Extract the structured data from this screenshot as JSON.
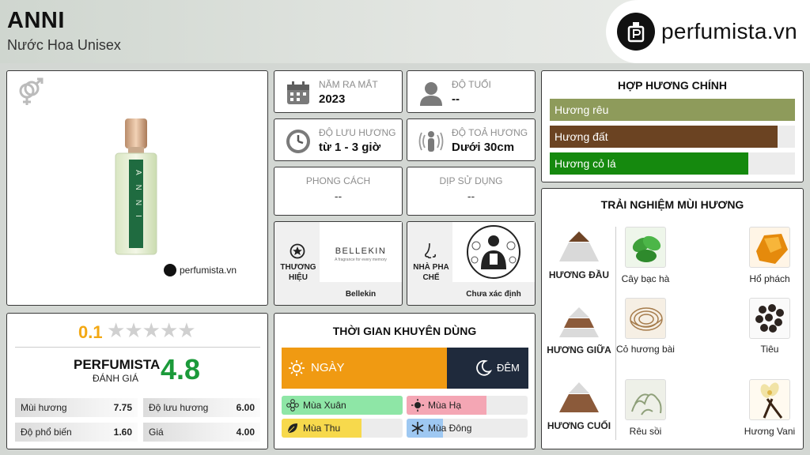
{
  "product": {
    "name": "ANNI",
    "subtitle": "Nước Hoa Unisex",
    "bottle_label": "ANNI"
  },
  "logo": {
    "text": "perfumista.vn"
  },
  "image_watermark": "perfumista.vn",
  "info": {
    "year_label": "NĂM RA MẮT",
    "year_value": "2023",
    "age_label": "ĐỘ TUỔI",
    "age_value": "--",
    "longevity_label": "ĐỘ LƯU HƯƠNG",
    "longevity_value": "từ 1 - 3 giờ",
    "sillage_label": "ĐỘ TOẢ HƯƠNG",
    "sillage_value": "Dưới 30cm",
    "style_label": "PHONG CÁCH",
    "style_value": "--",
    "occasion_label": "DỊP SỬ DỤNG",
    "occasion_value": "--",
    "brand_label": "THƯƠNG HIỆU",
    "brand_logo_main": "BELLEKIN",
    "brand_logo_tag": "A fragrance for every memory",
    "brand_value": "Bellekin",
    "perfumer_label": "NHÀ PHA CHẾ",
    "perfumer_value": "Chưa xác định"
  },
  "accords": {
    "title": "HỢP HƯƠNG CHÍNH",
    "items": [
      {
        "label": "Hương rêu",
        "percent": 100,
        "color": "#8e9b5b"
      },
      {
        "label": "Hương đất",
        "percent": 93,
        "color": "#6b4322"
      },
      {
        "label": "Hương cỏ lá",
        "percent": 81,
        "color": "#15890e"
      }
    ]
  },
  "rating": {
    "user_score": "0.1",
    "stars": [
      "★",
      "★",
      "★",
      "★",
      "★"
    ],
    "brand_label": "PERFUMISTA",
    "rate_label": "ĐÁNH GIÁ",
    "perfumista_score": "4.8",
    "stats": [
      {
        "label": "Mùi hương",
        "value": "7.75"
      },
      {
        "label": "Độ lưu hương",
        "value": "6.00"
      },
      {
        "label": "Độ phổ biến",
        "value": "1.60"
      },
      {
        "label": "Giá",
        "value": "4.00"
      }
    ]
  },
  "time": {
    "title": "THỜI GIAN KHUYÊN DÙNG",
    "day_label": "NGÀY",
    "night_label": "ĐÊM",
    "day_fraction": 0.67,
    "seasons": [
      {
        "label": "Mùa Xuân",
        "percent": 100,
        "color": "#8ee6a6"
      },
      {
        "label": "Mùa Hạ",
        "percent": 66,
        "color": "#f4a6b4"
      },
      {
        "label": "Mùa Thu",
        "percent": 66,
        "color": "#f7d94c"
      },
      {
        "label": "Mùa Đông",
        "percent": 30,
        "color": "#9ec8f2"
      }
    ]
  },
  "notes": {
    "title": "TRẢI NGHIỆM MÙI HƯƠNG",
    "top_label": "HƯƠNG ĐẦU",
    "mid_label": "HƯƠNG GIỮA",
    "base_label": "HƯƠNG CUỐI",
    "top": [
      "Cây bạc hà",
      "Hổ phách"
    ],
    "mid": [
      "Cỏ hương bài",
      "Tiêu"
    ],
    "base": [
      "Rêu sồi",
      "Hương Vani"
    ]
  },
  "icons": {
    "gender": "gender-symbol-icon",
    "year": "calendar-icon",
    "age": "person-icon",
    "longevity": "clock-icon",
    "sillage": "aura-person-icon",
    "brand": "star-badge-icon",
    "perfumer": "nose-icon",
    "day": "sun-icon",
    "night": "moon-icon"
  }
}
